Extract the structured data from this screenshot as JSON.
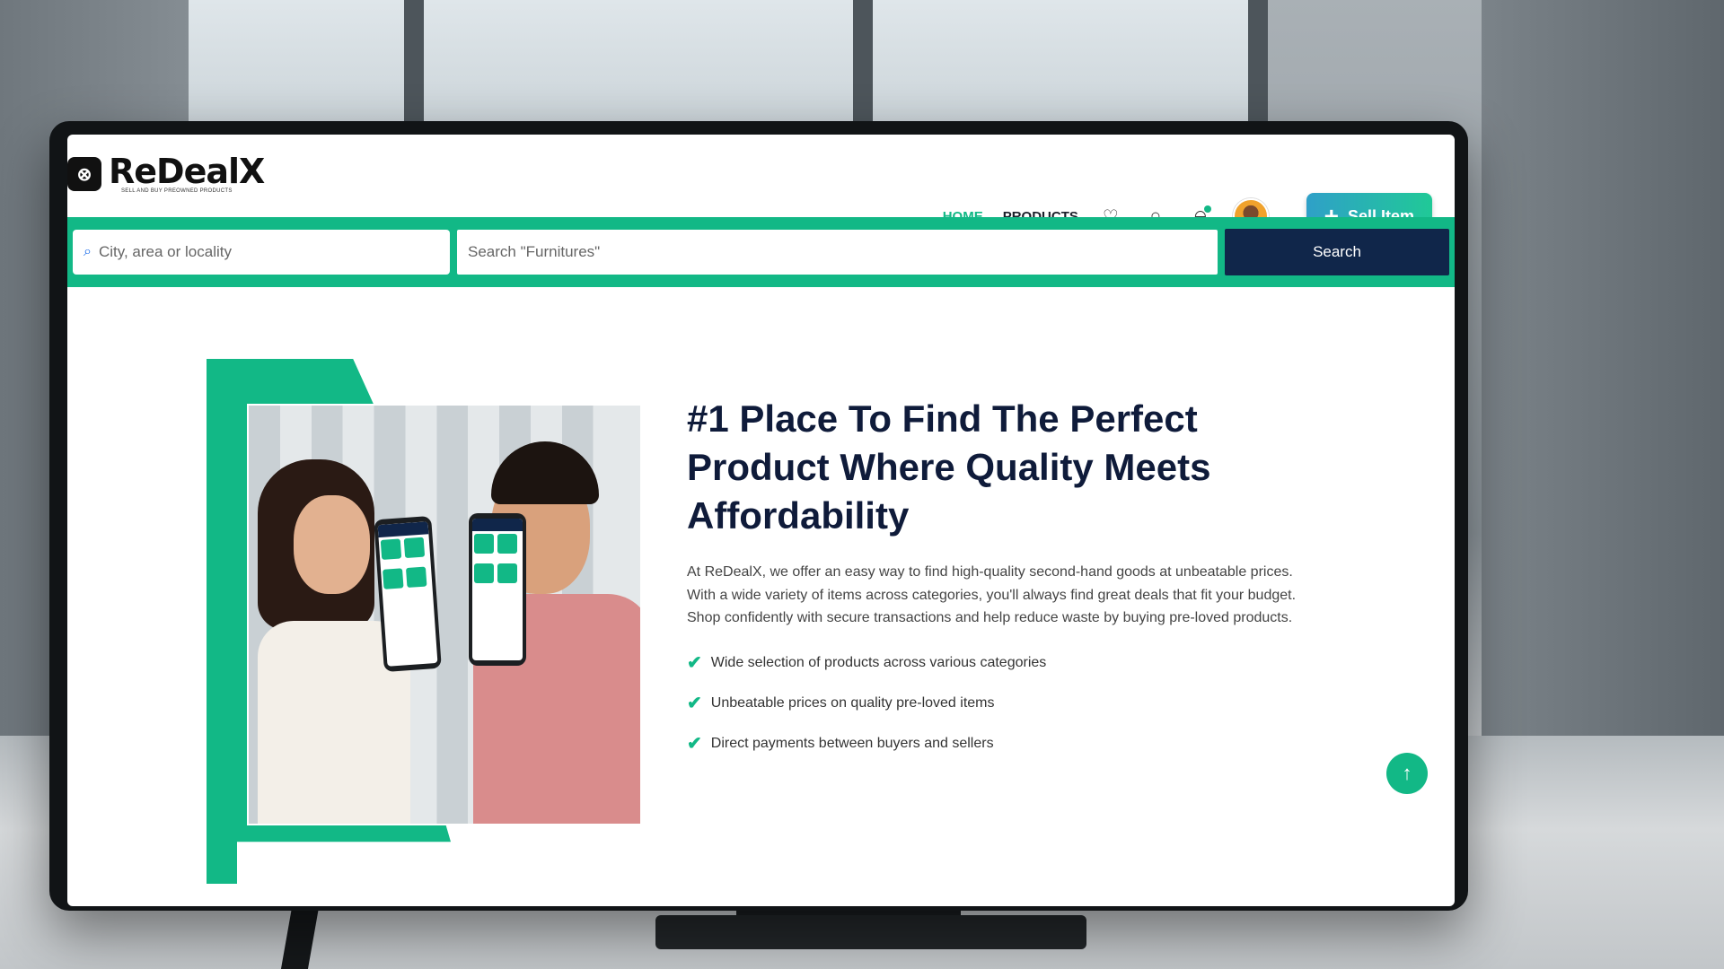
{
  "brand": {
    "name": "ReDealX",
    "tagline": "SELL AND BUY PREOWNED PRODUCTS",
    "logo_icon": "redealx-logo-icon"
  },
  "nav": {
    "home": "HOME",
    "products": "PRODUCTS",
    "icons": [
      "heart-icon",
      "chat-icon",
      "bell-icon"
    ],
    "sell_label": "Sell Item"
  },
  "search": {
    "location_placeholder": "City, area or locality",
    "query_placeholder": "Search \"Furnitures\"",
    "button_label": "Search"
  },
  "hero": {
    "title": "#1 Place To Find The Perfect Product Where Quality Meets Affordability",
    "description": "At ReDealX, we offer an easy way to find high-quality second-hand goods at unbeatable prices. With a wide variety of items across categories, you'll always find great deals that fit your budget. Shop confidently with secure transactions and help reduce waste by buying pre-loved products.",
    "features": [
      "Wide selection of products across various categories",
      "Unbeatable prices on quality pre-loved items",
      "Direct payments between buyers and sellers"
    ]
  },
  "colors": {
    "accent": "#12b886",
    "navy": "#10264a"
  }
}
